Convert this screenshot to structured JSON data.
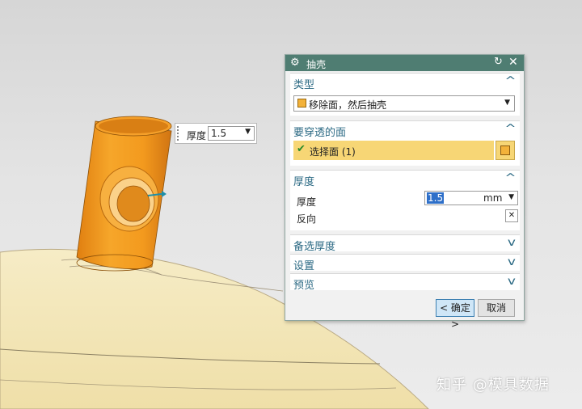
{
  "thickness_callout": {
    "label": "厚度",
    "value": "1.5"
  },
  "dialog": {
    "title": "抽壳",
    "sections": {
      "type": {
        "header": "类型",
        "selected": "移除面，然后抽壳"
      },
      "faces": {
        "header": "要穿透的面",
        "select_label": "选择面 (1)"
      },
      "thickness": {
        "header": "厚度",
        "thickness_label": "厚度",
        "thickness_value": "1.5",
        "unit": "mm",
        "reverse_label": "反向"
      },
      "alt_thickness": {
        "header": "备选厚度"
      },
      "settings": {
        "header": "设置"
      },
      "preview": {
        "header": "预览"
      }
    },
    "buttons": {
      "ok": "< 确定 >",
      "cancel": "取消"
    }
  },
  "watermark": "知乎 @模具数据",
  "colors": {
    "titlebar": "#4f7d72",
    "section_header": "#2c6a84",
    "selection_row": "#f7d675",
    "part_orange": "#f39a1e",
    "housing": "#f3e6b6"
  },
  "icons": {
    "gear": "gear-icon",
    "reset": "reset-icon",
    "close": "close-icon",
    "check": "check-icon",
    "face_select": "cube-icon",
    "reverse": "reverse-direction-icon"
  }
}
